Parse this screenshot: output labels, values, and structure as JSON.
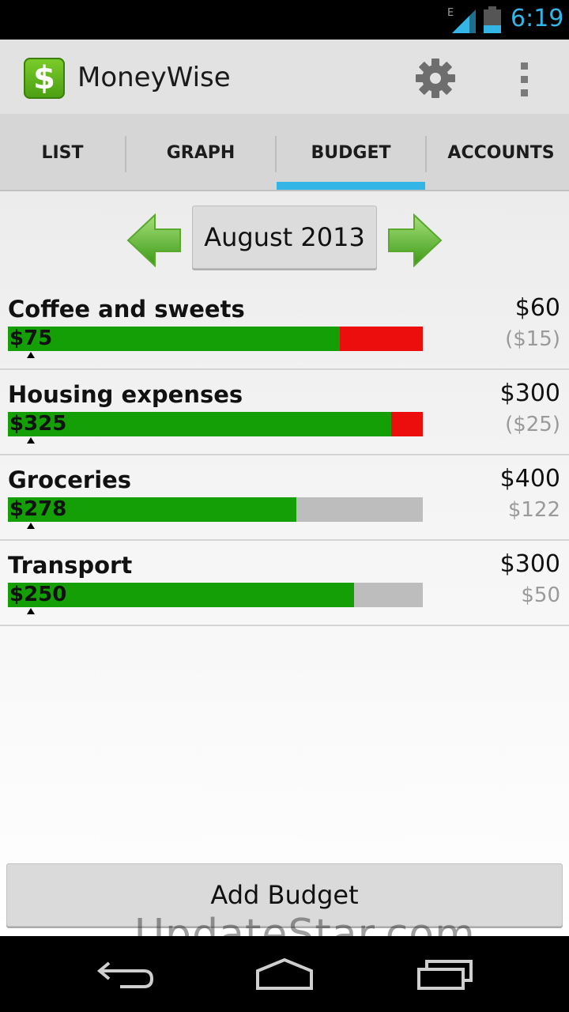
{
  "status_bar": {
    "network_label": "E",
    "time": "6:19",
    "icons": [
      "signal-icon",
      "battery-icon"
    ],
    "accent_color": "#33b5e5"
  },
  "action_bar": {
    "logo_glyph": "$",
    "title": "MoneyWise",
    "icons": [
      "gear-icon",
      "overflow-menu-icon"
    ]
  },
  "tabs": [
    {
      "label": "LIST",
      "selected": false
    },
    {
      "label": "GRAPH",
      "selected": false
    },
    {
      "label": "BUDGET",
      "selected": true
    },
    {
      "label": "ACCOUNTS",
      "selected": false
    }
  ],
  "month_nav": {
    "label": "August 2013",
    "icons": [
      "arrow-left-icon",
      "arrow-right-icon"
    ]
  },
  "budgets": [
    {
      "name": "Coffee and sweets",
      "spent": "$75",
      "limit": "$60",
      "remaining": "($15)",
      "spent_value": 75,
      "limit_value": 60
    },
    {
      "name": "Housing expenses",
      "spent": "$325",
      "limit": "$300",
      "remaining": "($25)",
      "spent_value": 325,
      "limit_value": 300
    },
    {
      "name": "Groceries",
      "spent": "$278",
      "limit": "$400",
      "remaining": "$122",
      "spent_value": 278,
      "limit_value": 400
    },
    {
      "name": "Transport",
      "spent": "$250",
      "limit": "$300",
      "remaining": "$50",
      "spent_value": 250,
      "limit_value": 300
    }
  ],
  "colors": {
    "spent": "#139f05",
    "over": "#ec0d0d",
    "unspent": "#bdbdbd"
  },
  "add_budget_label": "Add Budget",
  "watermark": "UpdateStar.com",
  "nav_bar": {
    "icons": [
      "back-icon",
      "home-icon",
      "recent-apps-icon"
    ]
  }
}
